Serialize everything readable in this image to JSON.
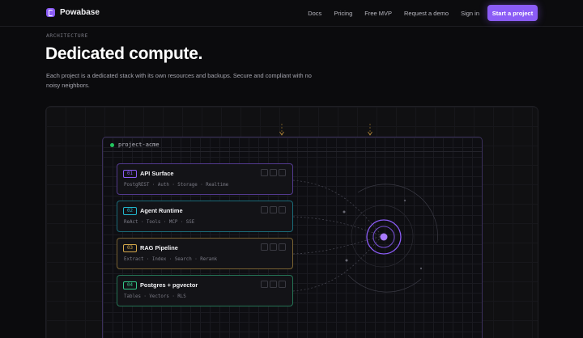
{
  "nav": {
    "brand": "Powabase",
    "links": [
      "Docs",
      "Pricing",
      "Free MVP",
      "Request a demo",
      "Sign in"
    ],
    "cta": "Start a project"
  },
  "hero": {
    "eyebrow": "ARCHITECTURE",
    "title": "Dedicated compute.",
    "description": "Each project is a dedicated stack with its own resources and backups. Secure and compliant with no noisy neighbors."
  },
  "diagram": {
    "project_name": "project-acme",
    "cards": [
      {
        "num": "01",
        "title": "API Surface",
        "sub": "PostgREST · Auth · Storage · Realtime",
        "color": "#8b5cf6"
      },
      {
        "num": "02",
        "title": "Agent Runtime",
        "sub": "ReAct · Tools · MCP · SSE",
        "color": "#22b8cf"
      },
      {
        "num": "03",
        "title": "RAG Pipeline",
        "sub": "Extract · Index · Search · Rerank",
        "color": "#d4a84a"
      },
      {
        "num": "04",
        "title": "Postgres + pgvector",
        "sub": "Tables · Vectors · RLS",
        "color": "#34c78a"
      }
    ],
    "status_color": "#22c55e",
    "accent": "#8b5cf6"
  }
}
